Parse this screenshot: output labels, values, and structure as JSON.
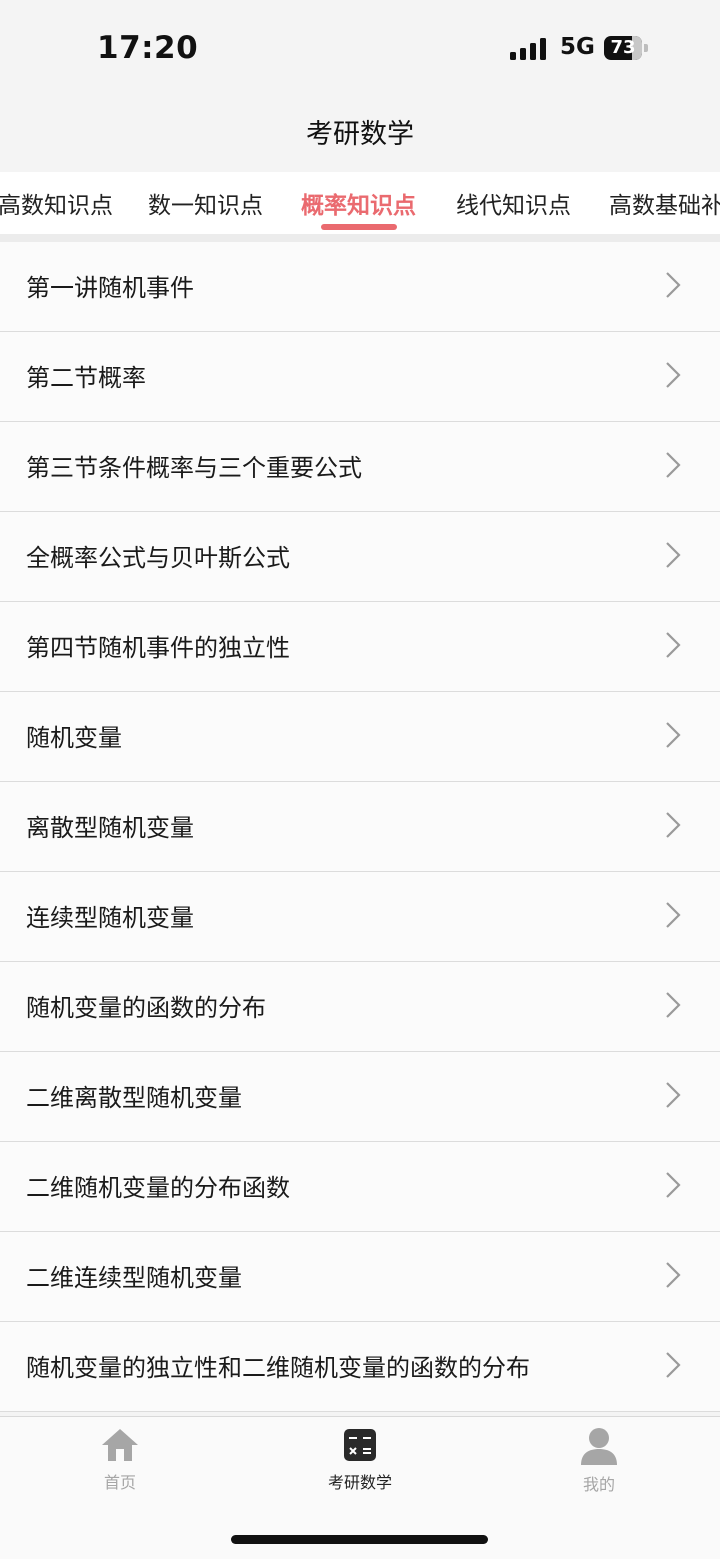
{
  "status_bar": {
    "time": "17:20",
    "network": "5G",
    "battery": "73"
  },
  "header": {
    "title": "考研数学"
  },
  "tabs": [
    {
      "label": "高数知识点"
    },
    {
      "label": "数一知识点"
    },
    {
      "label": "概率知识点",
      "active": true
    },
    {
      "label": "线代知识点"
    },
    {
      "label": "高数基础补"
    }
  ],
  "list": {
    "items": [
      {
        "label": "第一讲随机事件"
      },
      {
        "label": "第二节概率"
      },
      {
        "label": "第三节条件概率与三个重要公式"
      },
      {
        "label": "全概率公式与贝叶斯公式"
      },
      {
        "label": "第四节随机事件的独立性"
      },
      {
        "label": "随机变量"
      },
      {
        "label": "离散型随机变量"
      },
      {
        "label": "连续型随机变量"
      },
      {
        "label": "随机变量的函数的分布"
      },
      {
        "label": "二维离散型随机变量"
      },
      {
        "label": "二维随机变量的分布函数"
      },
      {
        "label": "二维连续型随机变量"
      },
      {
        "label": "随机变量的独立性和二维随机变量的函数的分布"
      }
    ]
  },
  "bottom_nav": {
    "items": [
      {
        "label": "首页",
        "icon": "home-icon"
      },
      {
        "label": "考研数学",
        "icon": "calculator-icon",
        "active": true
      },
      {
        "label": "我的",
        "icon": "profile-icon"
      }
    ]
  },
  "colors": {
    "accent": "#ea6a6f",
    "inactive": "#a6a6a6"
  }
}
